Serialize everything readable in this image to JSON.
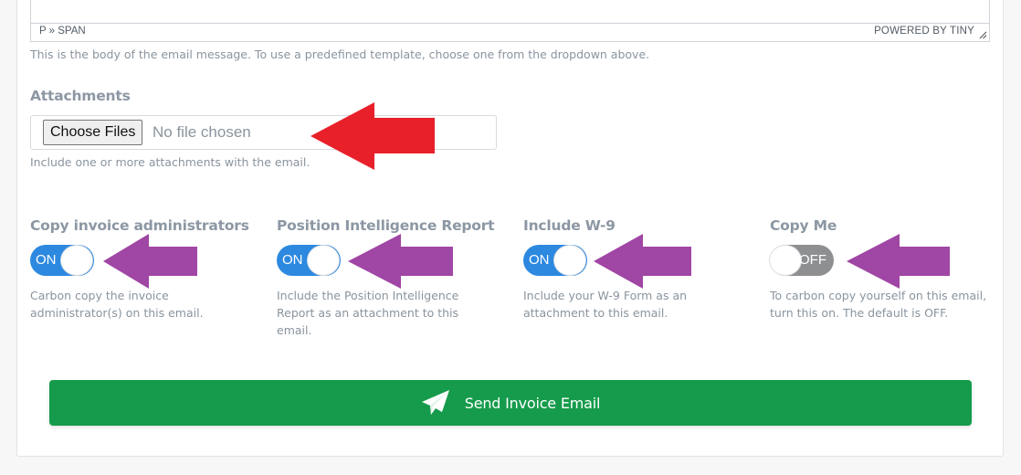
{
  "editor": {
    "path": "P » SPAN",
    "powered_by": "POWERED BY TINY",
    "help": "This is the body of the email message. To use a predefined template, choose one from the dropdown above."
  },
  "attachments": {
    "label": "Attachments",
    "button_label": "Choose Files",
    "status": "No file chosen",
    "help": "Include one or more attachments with the email."
  },
  "options": [
    {
      "label": "Copy invoice administrators",
      "state": "ON",
      "help": "Carbon copy the invoice administrator(s) on this email."
    },
    {
      "label": "Position Intelligence Report",
      "state": "ON",
      "help": "Include the Position Intelligence Report as an attachment to this email."
    },
    {
      "label": "Include W-9",
      "state": "ON",
      "help": "Include your W-9 Form as an attachment to this email."
    },
    {
      "label": "Copy Me",
      "state": "OFF",
      "help": "To carbon copy yourself on this email, turn this on. The default is OFF."
    }
  ],
  "send_button": {
    "label": "Send Invoice Email",
    "icon": "paper-plane-icon"
  },
  "colors": {
    "toggle_on": "#2d89e0",
    "toggle_off": "#8e8f91",
    "send_button": "#159b4b",
    "annotation_red": "#e8202a",
    "annotation_purple": "#a046a4"
  }
}
